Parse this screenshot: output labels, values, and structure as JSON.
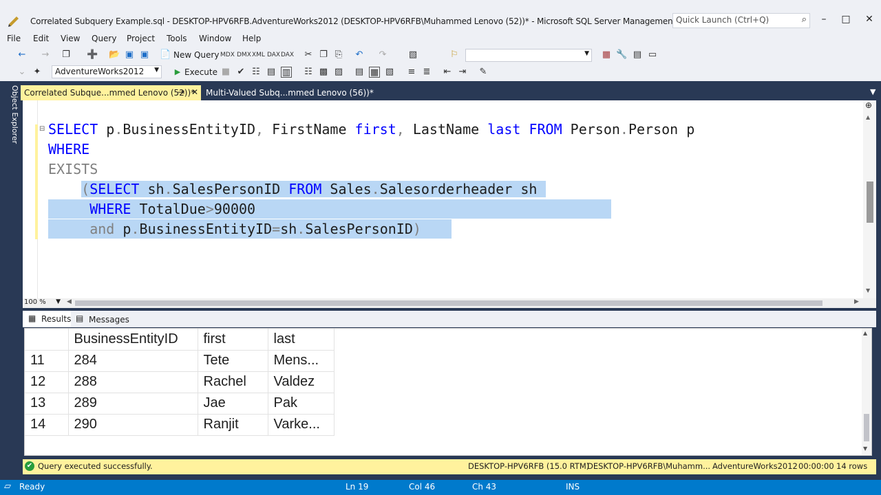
{
  "window": {
    "title": "Correlated Subquery Example.sql - DESKTOP-HPV6RFB.AdventureWorks2012 (DESKTOP-HPV6RFB\\Muhammed Lenovo (52))* - Microsoft SQL Server Management Studio (Adm...",
    "quick_launch_placeholder": "Quick Launch (Ctrl+Q)"
  },
  "menu": [
    "File",
    "Edit",
    "View",
    "Query",
    "Project",
    "Tools",
    "Window",
    "Help"
  ],
  "toolbar": {
    "new_query": "New Query",
    "database": "AdventureWorks2012",
    "execute": "Execute"
  },
  "object_explorer_label": "Object Explorer",
  "tabs": [
    {
      "label": "Correlated Subque...mmed Lenovo (52))*",
      "active": true
    },
    {
      "label": "Multi-Valued Subq...mmed Lenovo (56))*",
      "active": false
    }
  ],
  "code": {
    "line1": {
      "kw1": "SELECT",
      "t1": " p",
      "d1": ".",
      "t2": "BusinessEntityID",
      "c1": ",",
      "t3": " FirstName ",
      "kw2": "first",
      "c2": ",",
      "t4": " LastName ",
      "kw3": "last",
      "t5": " ",
      "kw4": "FROM",
      "t6": " Person",
      "d2": ".",
      "t7": "Person p"
    },
    "line2": {
      "kw1": "WHERE"
    },
    "line3": {
      "gr1": "EXISTS"
    },
    "line4": {
      "pad": "    ",
      "gr1": "(",
      "kw1": "SELECT",
      "t1": " sh",
      "d1": ".",
      "t2": "SalesPersonID ",
      "kw2": "FROM",
      "t3": " Sales",
      "d2": ".",
      "t4": "Salesorderheader sh "
    },
    "line5": {
      "pad": "     ",
      "kw1": "WHERE",
      "t1": " TotalDue",
      "gr1": ">",
      "t2": "90000"
    },
    "line6": {
      "pad": "     ",
      "gr1": "and",
      "t1": " p",
      "d1": ".",
      "t2": "BusinessEntityID",
      "gr2": "=",
      "t3": "sh",
      "d2": ".",
      "t4": "SalesPersonID",
      "gr3": ")"
    }
  },
  "zoom": "100 %",
  "result_tabs": {
    "results": "Results",
    "messages": "Messages"
  },
  "grid": {
    "headers": [
      "BusinessEntityID",
      "first",
      "last"
    ],
    "rows": [
      {
        "num": "11",
        "id": "284",
        "first": "Tete",
        "last": "Mens..."
      },
      {
        "num": "12",
        "id": "288",
        "first": "Rachel",
        "last": "Valdez"
      },
      {
        "num": "13",
        "id": "289",
        "first": "Jae",
        "last": "Pak"
      },
      {
        "num": "14",
        "id": "290",
        "first": "Ranjit",
        "last": "Varke..."
      }
    ]
  },
  "query_status": {
    "message": "Query executed successfully.",
    "server": "DESKTOP-HPV6RFB (15.0 RTM)",
    "user": "DESKTOP-HPV6RFB\\Muhamm...",
    "database": "AdventureWorks2012",
    "elapsed": "00:00:00",
    "rows": "14 rows"
  },
  "status_bar": {
    "state": "Ready",
    "ln": "Ln 19",
    "col": "Col 46",
    "ch": "Ch 43",
    "mode": "INS"
  },
  "colors": {
    "accent_blue": "#007acc",
    "tab_yellow": "#fff29d",
    "frame": "#293955",
    "selection": "#b9d7f5"
  }
}
